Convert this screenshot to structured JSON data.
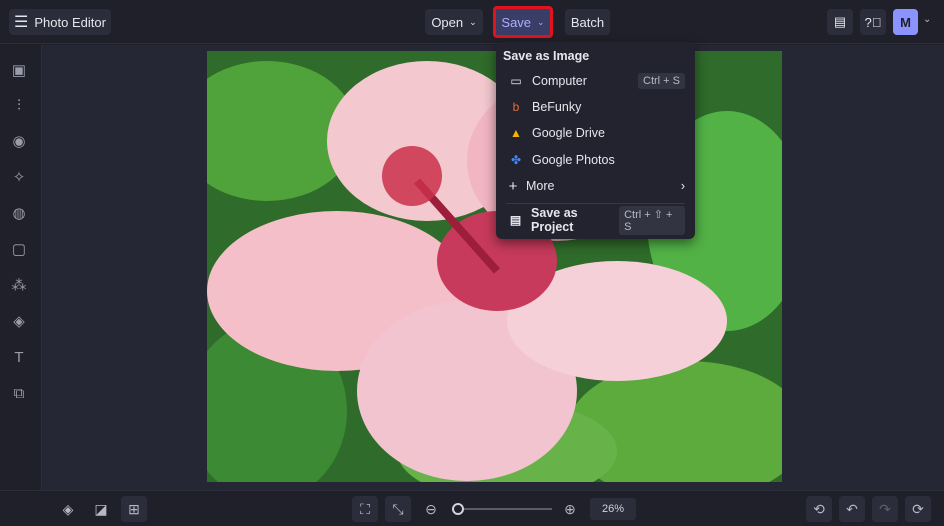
{
  "header": {
    "app_title": "Photo Editor",
    "open_label": "Open",
    "save_label": "Save",
    "batch_label": "Batch",
    "avatar_initial": "M"
  },
  "save_menu": {
    "heading": "Save as Image",
    "items": [
      {
        "label": "Computer",
        "shortcut": "Ctrl + S"
      },
      {
        "label": "BeFunky"
      },
      {
        "label": "Google Drive"
      },
      {
        "label": "Google Photos"
      },
      {
        "label": "More"
      }
    ],
    "project": {
      "label": "Save as Project",
      "shortcut": "Ctrl + ⇧ + S"
    }
  },
  "bottom": {
    "zoom_label": "26%",
    "zoom_value": 26
  },
  "colors": {
    "accent": "#8b93ff",
    "highlight": "#e0141e",
    "bg": "#1f2029"
  }
}
